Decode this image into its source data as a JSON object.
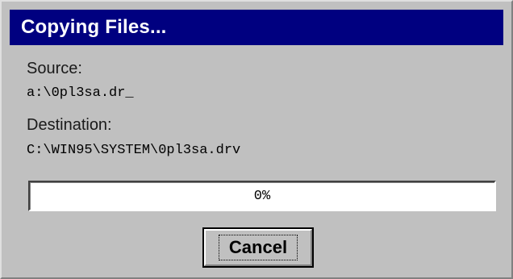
{
  "dialog": {
    "title": "Copying Files...",
    "source_label": "Source:",
    "source_path": "a:\\0pl3sa.dr_",
    "destination_label": "Destination:",
    "destination_path": "C:\\WIN95\\SYSTEM\\0pl3sa.drv",
    "progress": {
      "value": 0,
      "text": "0%"
    },
    "cancel_label": "Cancel"
  },
  "colors": {
    "titlebar": "#000080",
    "dialog_face": "#c0c0c0",
    "progress_fill": "#000080"
  }
}
